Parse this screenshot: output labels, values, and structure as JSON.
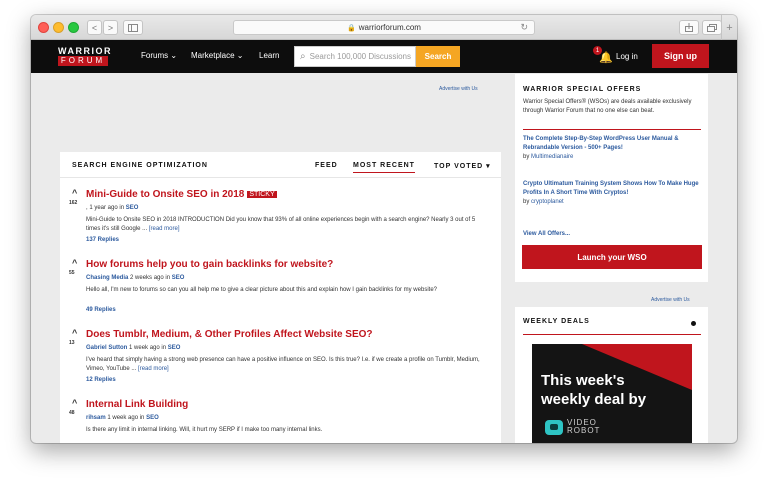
{
  "browser": {
    "url": "warriorforum.com",
    "nav_back": "<",
    "nav_forward": ">",
    "new_tab": "+"
  },
  "nav": {
    "logo_top": "WARRIOR",
    "logo_bottom": "FORUM",
    "links": [
      "Forums ⌄",
      "Marketplace ⌄",
      "Learn"
    ],
    "search_placeholder": "Search 100,000 Discussions",
    "search_button": "Search",
    "notification_count": "1",
    "login": "Log in",
    "signup": "Sign up"
  },
  "ads": {
    "top_label": "Advertise with Us",
    "sidebar_label": "Advertise with Us"
  },
  "main": {
    "section_title": "SEARCH ENGINE OPTIMIZATION",
    "tabs": [
      "FEED",
      "MOST RECENT",
      "TOP VOTED ▾"
    ],
    "active_tab": "MOST RECENT",
    "posts": [
      {
        "title": "Mini-Guide to Onsite SEO in 2018",
        "sticky": "STICKY",
        "votes": "162",
        "author": "",
        "meta": ", 1 year ago in",
        "category": "SEO",
        "excerpt": "Mini-Guide to Onsite SEO in 2018 INTRODUCTION Did you know that 93% of all online experiences begin with a search engine? Nearly 3 out of 5 times it's still Google ...",
        "read_more": "[read more]",
        "replies": "137 Replies"
      },
      {
        "title": "How forums help you to gain backlinks for website?",
        "votes": "55",
        "author": "Chasing Media",
        "meta": "2 weeks ago in",
        "category": "SEO",
        "excerpt": "Hello all, I'm new to forums so can you all help me to give a clear picture about this and explain how I gain backlinks for my website?",
        "replies": "49 Replies"
      },
      {
        "title": "Does Tumblr, Medium, & Other Profiles Affect Website SEO?",
        "votes": "13",
        "author": "Gabriel Sutton",
        "meta": "1 week ago in",
        "category": "SEO",
        "excerpt": "I've heard that simply having a strong web presence can have a positive influence on SEO. Is this true? I.e. if we create a profile on Tumblr, Medium, Vimeo, YouTube ...",
        "read_more": "[read more]",
        "replies": "12 Replies"
      },
      {
        "title": "Internal Link Building",
        "votes": "48",
        "author": "rihsam",
        "meta": "1 week ago in",
        "category": "SEO",
        "excerpt": "Is there any limit in internal linking. Will, it hurt my SERP if I make too many internal links."
      }
    ]
  },
  "sidebar": {
    "title": "WARRIOR SPECIAL OFFERS",
    "description": "Warrior Special Offers® (WSOs) are deals available exclusively through Warrior Forum that no one else can beat.",
    "offers": [
      {
        "title": "The Complete Step-By-Step WordPress User Manual & Rebrandable Version - 500+ Pages!",
        "by": "by",
        "author": "Multimedianaire"
      },
      {
        "title": "Crypto Ultimatum Training System Shows How To Make Huge Profits In A Short Time With Cryptos!",
        "by": "by",
        "author": "cryptoplanet"
      }
    ],
    "view_all": "View All Offers...",
    "launch_button": "Launch your WSO"
  },
  "weekly_deals": {
    "title": "WEEKLY DEALS",
    "banner_line1": "This week's",
    "banner_line2": "weekly deal by",
    "brand_line1": "VIDEO",
    "brand_line2": "ROBOT"
  },
  "colors": {
    "brand_red": "#c0151d",
    "search_orange": "#f5a623",
    "link_blue": "#2c5a9e",
    "nav_black": "#0d0d0d"
  }
}
